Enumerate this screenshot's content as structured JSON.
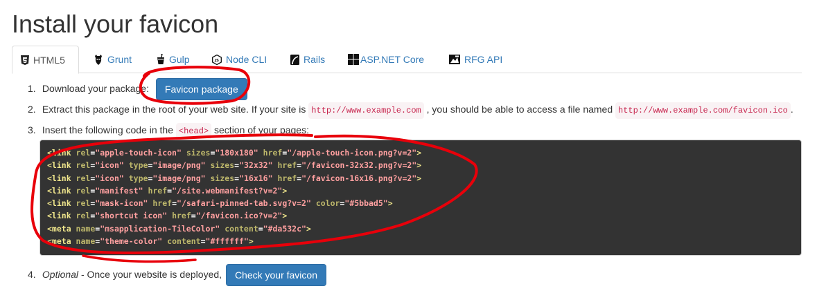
{
  "page": {
    "title": "Install your favicon"
  },
  "tabs": [
    {
      "label": "HTML5",
      "icon": "html5-icon",
      "active": true
    },
    {
      "label": "Grunt",
      "icon": "grunt-icon",
      "active": false
    },
    {
      "label": "Gulp",
      "icon": "gulp-icon",
      "active": false
    },
    {
      "label": "Node CLI",
      "icon": "nodejs-icon",
      "active": false
    },
    {
      "label": "Rails",
      "icon": "rails-icon",
      "active": false
    },
    {
      "label": "ASP.NET Core",
      "icon": "windows-icon",
      "active": false
    },
    {
      "label": "RFG API",
      "icon": "api-icon",
      "active": false
    }
  ],
  "steps": {
    "s1": {
      "num": "1.",
      "text": "Download your package:",
      "button": "Favicon package"
    },
    "s2": {
      "num": "2.",
      "text_a": "Extract this package in the root of your web site. If your site is",
      "code_a": "http://www.example.com",
      "text_b": ", you should be able to access a file named",
      "code_b": "http://www.example.com/favicon.ico",
      "text_c": "."
    },
    "s3": {
      "num": "3.",
      "text_a": "Insert the following code in the",
      "code": "<head>",
      "text_b": "section of your pages:"
    },
    "s4": {
      "num": "4.",
      "optional": "Optional",
      "text": "- Once your website is deployed,",
      "button": "Check your favicon"
    }
  },
  "code_lines": [
    [
      [
        "tag",
        "<link "
      ],
      [
        "attr",
        "rel"
      ],
      [
        "eq",
        "="
      ],
      [
        "val",
        "\"apple-touch-icon\""
      ],
      [
        "sp",
        " "
      ],
      [
        "attr",
        "sizes"
      ],
      [
        "eq",
        "="
      ],
      [
        "val",
        "\"180x180\""
      ],
      [
        "sp",
        " "
      ],
      [
        "attr",
        "href"
      ],
      [
        "eq",
        "="
      ],
      [
        "val",
        "\"/apple-touch-icon.png?v=2\""
      ],
      [
        "tag",
        ">"
      ]
    ],
    [
      [
        "tag",
        "<link "
      ],
      [
        "attr",
        "rel"
      ],
      [
        "eq",
        "="
      ],
      [
        "val",
        "\"icon\""
      ],
      [
        "sp",
        " "
      ],
      [
        "attr",
        "type"
      ],
      [
        "eq",
        "="
      ],
      [
        "val",
        "\"image/png\""
      ],
      [
        "sp",
        " "
      ],
      [
        "attr",
        "sizes"
      ],
      [
        "eq",
        "="
      ],
      [
        "val",
        "\"32x32\""
      ],
      [
        "sp",
        " "
      ],
      [
        "attr",
        "href"
      ],
      [
        "eq",
        "="
      ],
      [
        "val",
        "\"/favicon-32x32.png?v=2\""
      ],
      [
        "tag",
        ">"
      ]
    ],
    [
      [
        "tag",
        "<link "
      ],
      [
        "attr",
        "rel"
      ],
      [
        "eq",
        "="
      ],
      [
        "val",
        "\"icon\""
      ],
      [
        "sp",
        " "
      ],
      [
        "attr",
        "type"
      ],
      [
        "eq",
        "="
      ],
      [
        "val",
        "\"image/png\""
      ],
      [
        "sp",
        " "
      ],
      [
        "attr",
        "sizes"
      ],
      [
        "eq",
        "="
      ],
      [
        "val",
        "\"16x16\""
      ],
      [
        "sp",
        " "
      ],
      [
        "attr",
        "href"
      ],
      [
        "eq",
        "="
      ],
      [
        "val",
        "\"/favicon-16x16.png?v=2\""
      ],
      [
        "tag",
        ">"
      ]
    ],
    [
      [
        "tag",
        "<link "
      ],
      [
        "attr",
        "rel"
      ],
      [
        "eq",
        "="
      ],
      [
        "val",
        "\"manifest\""
      ],
      [
        "sp",
        " "
      ],
      [
        "attr",
        "href"
      ],
      [
        "eq",
        "="
      ],
      [
        "val",
        "\"/site.webmanifest?v=2\""
      ],
      [
        "tag",
        ">"
      ]
    ],
    [
      [
        "tag",
        "<link "
      ],
      [
        "attr",
        "rel"
      ],
      [
        "eq",
        "="
      ],
      [
        "val",
        "\"mask-icon\""
      ],
      [
        "sp",
        " "
      ],
      [
        "attr",
        "href"
      ],
      [
        "eq",
        "="
      ],
      [
        "val",
        "\"/safari-pinned-tab.svg?v=2\""
      ],
      [
        "sp",
        " "
      ],
      [
        "attr",
        "color"
      ],
      [
        "eq",
        "="
      ],
      [
        "val",
        "\"#5bbad5\""
      ],
      [
        "tag",
        ">"
      ]
    ],
    [
      [
        "tag",
        "<link "
      ],
      [
        "attr",
        "rel"
      ],
      [
        "eq",
        "="
      ],
      [
        "val",
        "\"shortcut icon\""
      ],
      [
        "sp",
        " "
      ],
      [
        "attr",
        "href"
      ],
      [
        "eq",
        "="
      ],
      [
        "val",
        "\"/favicon.ico?v=2\""
      ],
      [
        "tag",
        ">"
      ]
    ],
    [
      [
        "tag",
        "<meta "
      ],
      [
        "attr",
        "name"
      ],
      [
        "eq",
        "="
      ],
      [
        "val",
        "\"msapplication-TileColor\""
      ],
      [
        "sp",
        " "
      ],
      [
        "attr",
        "content"
      ],
      [
        "eq",
        "="
      ],
      [
        "val",
        "\"#da532c\""
      ],
      [
        "tag",
        ">"
      ]
    ],
    [
      [
        "tag",
        "<meta "
      ],
      [
        "attr",
        "name"
      ],
      [
        "eq",
        "="
      ],
      [
        "val",
        "\"theme-color\""
      ],
      [
        "sp",
        " "
      ],
      [
        "attr",
        "content"
      ],
      [
        "eq",
        "="
      ],
      [
        "val",
        "\"#ffffff\""
      ],
      [
        "tag",
        ">"
      ]
    ]
  ],
  "colors": {
    "link": "#337ab7",
    "button": "#337ab7",
    "code_bg": "#333333",
    "annotation": "#e8000a"
  }
}
